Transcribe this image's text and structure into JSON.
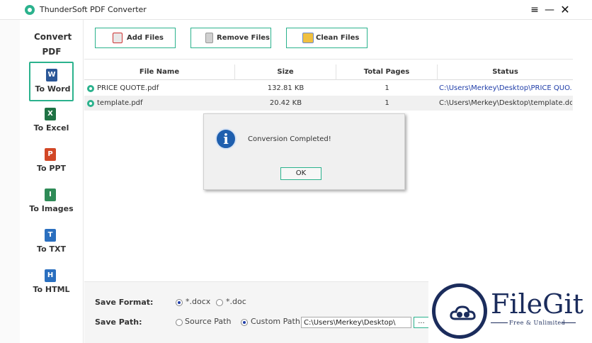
{
  "window": {
    "title": "ThunderSoft PDF Converter",
    "menu_glyph": "≡",
    "minimize_glyph": "—",
    "close_glyph": "✕"
  },
  "sidebar": {
    "heading": "Convert PDF",
    "items": [
      {
        "label": "To Word",
        "icon": "word-icon",
        "color": "#2b5797",
        "glyph": "W"
      },
      {
        "label": "To Excel",
        "icon": "excel-icon",
        "color": "#1f7244",
        "glyph": "X"
      },
      {
        "label": "To PPT",
        "icon": "ppt-icon",
        "color": "#d24726",
        "glyph": "P"
      },
      {
        "label": "To Images",
        "icon": "images-icon",
        "color": "#2e8b57",
        "glyph": "I"
      },
      {
        "label": "To TXT",
        "icon": "txt-icon",
        "color": "#2a6fbf",
        "glyph": "T"
      },
      {
        "label": "To HTML",
        "icon": "html-icon",
        "color": "#2a6fbf",
        "glyph": "H"
      }
    ],
    "active_index": 0
  },
  "toolbar": {
    "add_label": "Add Files",
    "remove_label": "Remove Files",
    "clean_label": "Clean Files"
  },
  "table": {
    "columns": [
      "File Name",
      "Size",
      "Total Pages",
      "Status"
    ],
    "rows": [
      {
        "name": "PRICE QUOTE.pdf",
        "size": "132.81 KB",
        "pages": "1",
        "status": "C:\\Users\\Merkey\\Desktop\\PRICE QUO..."
      },
      {
        "name": "template.pdf",
        "size": "20.42 KB",
        "pages": "1",
        "status": "C:\\Users\\Merkey\\Desktop\\template.do..."
      }
    ]
  },
  "dialog": {
    "message": "Conversion Completed!",
    "ok_label": "OK",
    "icon_glyph": "i"
  },
  "settings": {
    "format_label": "Save Format:",
    "format_options": [
      "*.docx",
      "*.doc"
    ],
    "format_selected": "*.docx",
    "path_label": "Save Path:",
    "path_options": [
      "Source Path",
      "Custom Path"
    ],
    "path_selected": "Custom Path",
    "path_value": "C:\\Users\\Merkey\\Desktop\\",
    "browse_label": "..."
  },
  "watermark": {
    "brand": "FileGit",
    "tagline": "Free & Unlimited",
    "color": "#1b2c5c"
  },
  "colors": {
    "accent": "#2bb28d",
    "link": "#1f3da8"
  }
}
